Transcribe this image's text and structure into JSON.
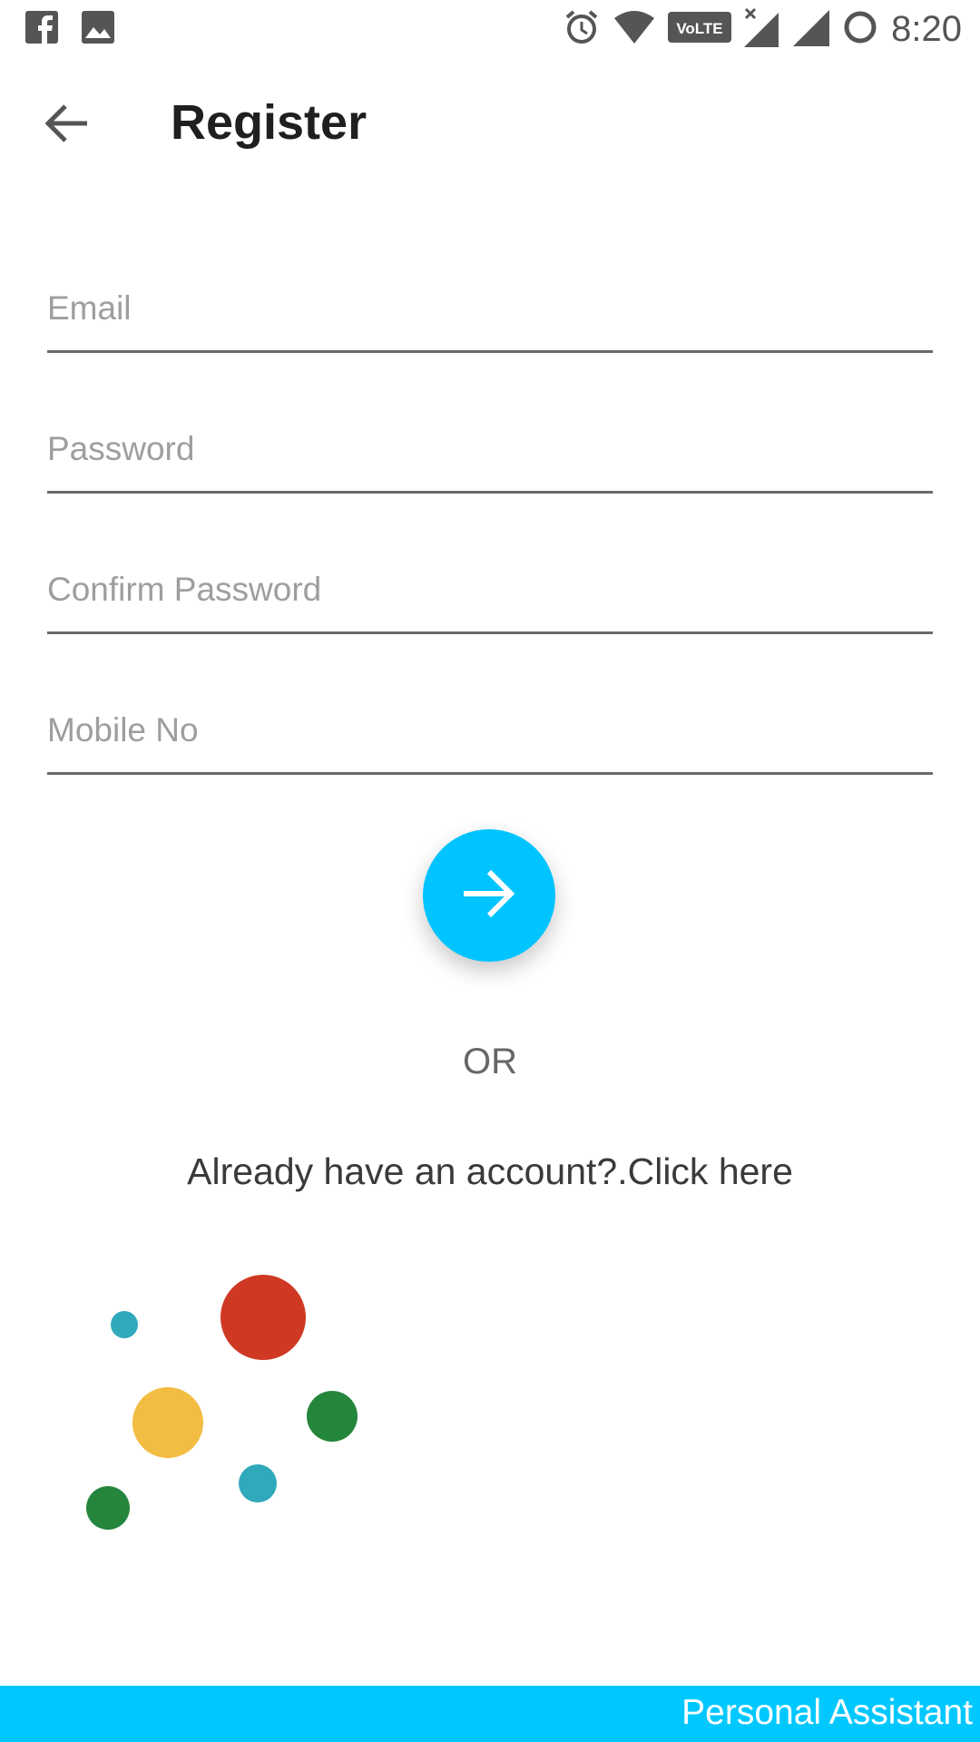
{
  "status_bar": {
    "time": "8:20",
    "network_badge": "VoLTE",
    "icons": [
      "facebook-icon",
      "gallery-icon",
      "alarm-icon",
      "wifi-icon",
      "volte-icon",
      "signal-x-icon",
      "signal-icon",
      "battery-ring-icon"
    ]
  },
  "appbar": {
    "title": "Register",
    "back_icon": "arrow-back-icon"
  },
  "form": {
    "email_placeholder": "Email",
    "password_placeholder": "Password",
    "confirm_password_placeholder": "Confirm Password",
    "mobile_placeholder": "Mobile No"
  },
  "submit": {
    "icon": "arrow-forward-icon"
  },
  "or_text": "OR",
  "login_link": "Already have an account?.Click here",
  "decoration": {
    "colors": {
      "red": "#cf3923",
      "yellow": "#f2bd42",
      "green": "#24863b",
      "teal": "#30a9bb"
    }
  },
  "footer": {
    "label": "Personal Assistant"
  },
  "colors": {
    "accent": "#00c4ff",
    "footer": "#00c8ff"
  }
}
